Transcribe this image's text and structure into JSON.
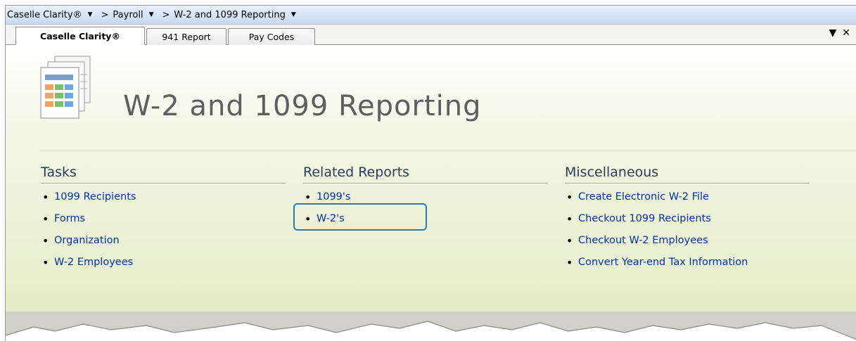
{
  "breadcrumb": {
    "items": [
      {
        "label": "Caselle Clarity®"
      },
      {
        "label": "Payroll"
      },
      {
        "label": "W-2 and 1099 Reporting"
      }
    ],
    "separator": ">"
  },
  "tabs": [
    {
      "label": "Caselle Clarity®",
      "active": true
    },
    {
      "label": "941 Report",
      "active": false
    },
    {
      "label": "Pay Codes",
      "active": false
    }
  ],
  "tab_controls": {
    "dropdown_icon": "chevron-down-icon",
    "close_icon": "close-icon"
  },
  "page": {
    "title": "W-2 and 1099 Reporting",
    "icon": "report-document-icon"
  },
  "sections": {
    "tasks": {
      "title": "Tasks",
      "items": [
        "1099 Recipients",
        "Forms",
        "Organization",
        "W-2 Employees"
      ]
    },
    "related_reports": {
      "title": "Related Reports",
      "items": [
        "1099's",
        "W-2's"
      ],
      "highlighted_item": "W-2's"
    },
    "miscellaneous": {
      "title": "Miscellaneous",
      "items": [
        "Create Electronic W-2 File",
        "Checkout 1099 Recipients",
        "Checkout W-2 Employees",
        "Convert Year-end Tax Information"
      ]
    }
  },
  "colors": {
    "link": "#003399",
    "title": "#5e5e5e",
    "highlight_border": "#2e7ba7",
    "breadcrumb_bg": "#d6e4f5"
  }
}
